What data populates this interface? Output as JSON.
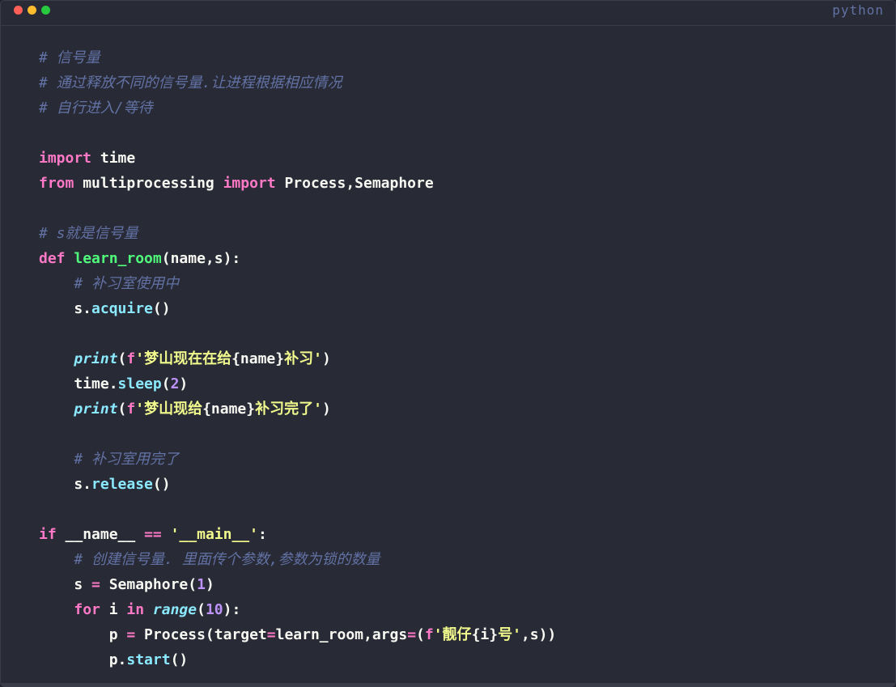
{
  "window": {
    "language_label": "python"
  },
  "code": {
    "lines": [
      [
        {
          "t": "comment",
          "v": "# 信号量"
        }
      ],
      [
        {
          "t": "comment",
          "v": "# 通过释放不同的信号量.让进程根据相应情况"
        }
      ],
      [
        {
          "t": "comment",
          "v": "# 自行进入/等待"
        }
      ],
      [],
      [
        {
          "t": "keyword",
          "v": "import"
        },
        {
          "t": "plain",
          "v": " time"
        }
      ],
      [
        {
          "t": "keyword",
          "v": "from"
        },
        {
          "t": "plain",
          "v": " multiprocessing "
        },
        {
          "t": "keyword",
          "v": "import"
        },
        {
          "t": "plain",
          "v": " Process,Semaphore"
        }
      ],
      [],
      [
        {
          "t": "comment",
          "v": "# s就是信号量"
        }
      ],
      [
        {
          "t": "keyword",
          "v": "def"
        },
        {
          "t": "plain",
          "v": " "
        },
        {
          "t": "funcname",
          "v": "learn_room"
        },
        {
          "t": "plain",
          "v": "(name,s):"
        }
      ],
      [
        {
          "t": "plain",
          "v": "    "
        },
        {
          "t": "comment",
          "v": "# 补习室使用中"
        }
      ],
      [
        {
          "t": "plain",
          "v": "    s."
        },
        {
          "t": "method",
          "v": "acquire"
        },
        {
          "t": "plain",
          "v": "()"
        }
      ],
      [],
      [
        {
          "t": "plain",
          "v": "    "
        },
        {
          "t": "builtin",
          "v": "print"
        },
        {
          "t": "plain",
          "v": "("
        },
        {
          "t": "keyword",
          "v": "f"
        },
        {
          "t": "string",
          "v": "'梦山现在在给"
        },
        {
          "t": "plain",
          "v": "{name}"
        },
        {
          "t": "string",
          "v": "补习'"
        },
        {
          "t": "plain",
          "v": ")"
        }
      ],
      [
        {
          "t": "plain",
          "v": "    time."
        },
        {
          "t": "method",
          "v": "sleep"
        },
        {
          "t": "plain",
          "v": "("
        },
        {
          "t": "number",
          "v": "2"
        },
        {
          "t": "plain",
          "v": ")"
        }
      ],
      [
        {
          "t": "plain",
          "v": "    "
        },
        {
          "t": "builtin",
          "v": "print"
        },
        {
          "t": "plain",
          "v": "("
        },
        {
          "t": "keyword",
          "v": "f"
        },
        {
          "t": "string",
          "v": "'梦山现给"
        },
        {
          "t": "plain",
          "v": "{name}"
        },
        {
          "t": "string",
          "v": "补习完了'"
        },
        {
          "t": "plain",
          "v": ")"
        }
      ],
      [],
      [
        {
          "t": "plain",
          "v": "    "
        },
        {
          "t": "comment",
          "v": "# 补习室用完了"
        }
      ],
      [
        {
          "t": "plain",
          "v": "    s."
        },
        {
          "t": "method",
          "v": "release"
        },
        {
          "t": "plain",
          "v": "()"
        }
      ],
      [],
      [
        {
          "t": "keyword",
          "v": "if"
        },
        {
          "t": "plain",
          "v": " __name__ "
        },
        {
          "t": "operator",
          "v": "=="
        },
        {
          "t": "plain",
          "v": " "
        },
        {
          "t": "string",
          "v": "'__main__'"
        },
        {
          "t": "plain",
          "v": ":"
        }
      ],
      [
        {
          "t": "plain",
          "v": "    "
        },
        {
          "t": "comment",
          "v": "# 创建信号量. 里面传个参数,参数为锁的数量"
        }
      ],
      [
        {
          "t": "plain",
          "v": "    s "
        },
        {
          "t": "operator",
          "v": "="
        },
        {
          "t": "plain",
          "v": " Semaphore("
        },
        {
          "t": "number",
          "v": "1"
        },
        {
          "t": "plain",
          "v": ")"
        }
      ],
      [
        {
          "t": "plain",
          "v": "    "
        },
        {
          "t": "keyword",
          "v": "for"
        },
        {
          "t": "plain",
          "v": " i "
        },
        {
          "t": "keyword",
          "v": "in"
        },
        {
          "t": "plain",
          "v": " "
        },
        {
          "t": "builtin",
          "v": "range"
        },
        {
          "t": "plain",
          "v": "("
        },
        {
          "t": "number",
          "v": "10"
        },
        {
          "t": "plain",
          "v": "):"
        }
      ],
      [
        {
          "t": "plain",
          "v": "        p "
        },
        {
          "t": "operator",
          "v": "="
        },
        {
          "t": "plain",
          "v": " Process(target"
        },
        {
          "t": "operator",
          "v": "="
        },
        {
          "t": "plain",
          "v": "learn_room,args"
        },
        {
          "t": "operator",
          "v": "="
        },
        {
          "t": "plain",
          "v": "("
        },
        {
          "t": "keyword",
          "v": "f"
        },
        {
          "t": "string",
          "v": "'靓仔"
        },
        {
          "t": "plain",
          "v": "{i}"
        },
        {
          "t": "string",
          "v": "号'"
        },
        {
          "t": "plain",
          "v": ",s))"
        }
      ],
      [
        {
          "t": "plain",
          "v": "        p."
        },
        {
          "t": "method",
          "v": "start"
        },
        {
          "t": "plain",
          "v": "()"
        }
      ]
    ]
  }
}
